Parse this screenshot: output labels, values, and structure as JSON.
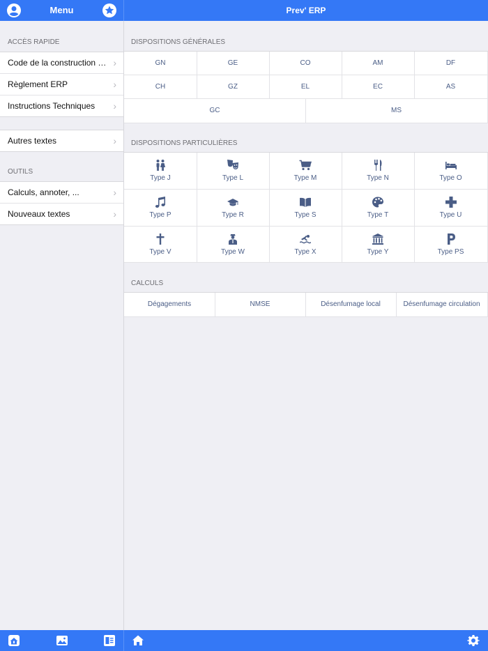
{
  "header": {
    "menu_title": "Menu",
    "app_title": "Prev' ERP",
    "accent_color": "#3478f6"
  },
  "sidebar": {
    "section_quick": "ACCÈS RAPIDE",
    "quick_items": [
      {
        "label": "Code de la construction e..."
      },
      {
        "label": "Règlement ERP"
      },
      {
        "label": "Instructions Techniques"
      }
    ],
    "other_item": {
      "label": "Autres textes"
    },
    "section_tools": "OUTILS",
    "tool_items": [
      {
        "label": "Calculs, annoter, ..."
      },
      {
        "label": "Nouveaux textes"
      }
    ]
  },
  "main": {
    "general_header": "DISPOSITIONS GÉNÉRALES",
    "general": [
      "GN",
      "GE",
      "CO",
      "AM",
      "DF",
      "CH",
      "GZ",
      "EL",
      "EC",
      "AS",
      "GC",
      "MS"
    ],
    "particular_header": "DISPOSITIONS PARTICULIÈRES",
    "types": [
      {
        "label": "Type J",
        "icon": "people-icon"
      },
      {
        "label": "Type L",
        "icon": "theater-masks-icon"
      },
      {
        "label": "Type M",
        "icon": "shopping-cart-icon"
      },
      {
        "label": "Type N",
        "icon": "fork-knife-icon"
      },
      {
        "label": "Type O",
        "icon": "bed-icon"
      },
      {
        "label": "Type P",
        "icon": "music-note-icon"
      },
      {
        "label": "Type R",
        "icon": "graduation-cap-icon"
      },
      {
        "label": "Type S",
        "icon": "open-book-icon"
      },
      {
        "label": "Type T",
        "icon": "palette-icon"
      },
      {
        "label": "Type U",
        "icon": "medical-cross-icon"
      },
      {
        "label": "Type V",
        "icon": "latin-cross-icon"
      },
      {
        "label": "Type W",
        "icon": "office-worker-icon"
      },
      {
        "label": "Type X",
        "icon": "swimmer-icon"
      },
      {
        "label": "Type Y",
        "icon": "museum-icon"
      },
      {
        "label": "Type PS",
        "icon": "parking-icon"
      }
    ],
    "calc_header": "CALCULS",
    "calcs": [
      "Dégagements",
      "NMSE",
      "Désenfumage local",
      "Désenfumage circulation"
    ]
  },
  "footer": {
    "icons": [
      "home-fire-icon",
      "home-picture-icon",
      "building-list-icon",
      "home-icon",
      "gear-icon"
    ]
  }
}
